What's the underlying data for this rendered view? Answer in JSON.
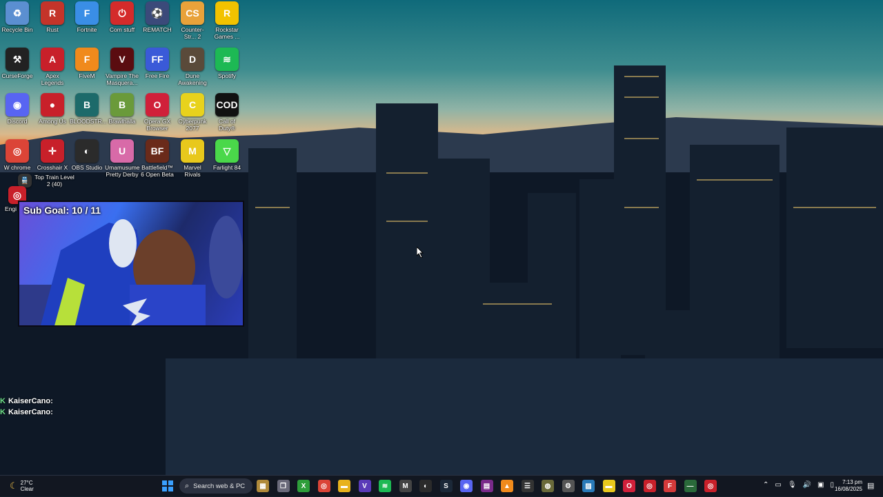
{
  "desktop": {
    "icons": [
      {
        "label": "Recycle Bin",
        "icon": "recycle-bin-icon",
        "color": "#5b8fd1",
        "glyph": "♻"
      },
      {
        "label": "Rust",
        "icon": "rust-icon",
        "color": "#c4342a",
        "glyph": "R"
      },
      {
        "label": "Fortnite",
        "icon": "fortnite-icon",
        "color": "#3a8ee6",
        "glyph": "F"
      },
      {
        "label": "Com stuff",
        "icon": "power-icon",
        "color": "#d42b2b",
        "glyph": "⏻"
      },
      {
        "label": "REMATCH",
        "icon": "rematch-icon",
        "color": "#3b4a7a",
        "glyph": "⚽"
      },
      {
        "label": "Counter-Str... 2",
        "icon": "counter-strike-icon",
        "color": "#e8a23a",
        "glyph": "CS"
      },
      {
        "label": "Rockstar Games ...",
        "icon": "rockstar-icon",
        "color": "#f2c200",
        "glyph": "R"
      },
      {
        "label": "CurseForge",
        "icon": "curseforge-icon",
        "color": "#222222",
        "glyph": "⚒"
      },
      {
        "label": "Apex Legends",
        "icon": "apex-icon",
        "color": "#c8202a",
        "glyph": "A"
      },
      {
        "label": "FiveM",
        "icon": "fivem-icon",
        "color": "#f08a1c",
        "glyph": "F"
      },
      {
        "label": "Vampire The Masquera...",
        "icon": "vampire-icon",
        "color": "#5a0c10",
        "glyph": "V"
      },
      {
        "label": "Free Fire",
        "icon": "free-fire-icon",
        "color": "#3a5ad8",
        "glyph": "FF"
      },
      {
        "label": "Dune Awakening",
        "icon": "dune-icon",
        "color": "#5a4a3a",
        "glyph": "D"
      },
      {
        "label": "Spotify",
        "icon": "spotify-icon",
        "color": "#1db954",
        "glyph": "≋"
      },
      {
        "label": "Discord",
        "icon": "discord-icon",
        "color": "#5865f2",
        "glyph": "◉"
      },
      {
        "label": "Among Us",
        "icon": "among-us-icon",
        "color": "#c8202a",
        "glyph": "●"
      },
      {
        "label": "BLOODSTR...",
        "icon": "bloodstrike-icon",
        "color": "#1d6a6a",
        "glyph": "B"
      },
      {
        "label": "Brawlhalla",
        "icon": "brawlhalla-icon",
        "color": "#6a9a3a",
        "glyph": "B"
      },
      {
        "label": "Opera GX Browser",
        "icon": "opera-gx-icon",
        "color": "#d0203a",
        "glyph": "O"
      },
      {
        "label": "Cyberpunk 2077",
        "icon": "cyberpunk-icon",
        "color": "#e8d21c",
        "glyph": "C"
      },
      {
        "label": "Call of Duty®",
        "icon": "call-of-duty-icon",
        "color": "#111111",
        "glyph": "COD"
      },
      {
        "label": "W chrome",
        "icon": "chrome-icon",
        "color": "#db4437",
        "glyph": "◎"
      },
      {
        "label": "Crosshair X",
        "icon": "crosshair-icon",
        "color": "#c8202a",
        "glyph": "✛"
      },
      {
        "label": "OBS Studio",
        "icon": "obs-icon",
        "color": "#2b2b2b",
        "glyph": "◐"
      },
      {
        "label": "Umamusume Pretty Derby",
        "icon": "umamusume-icon",
        "color": "#d86aa8",
        "glyph": "U"
      },
      {
        "label": "Battlefield™ 6 Open Beta",
        "icon": "battlefield-icon",
        "color": "#6a2a1a",
        "glyph": "BF"
      },
      {
        "label": "Marvel Rivals",
        "icon": "marvel-rivals-icon",
        "color": "#e8c81c",
        "glyph": "M"
      },
      {
        "label": "Farlight 84",
        "icon": "farlight-icon",
        "color": "#4ad84a",
        "glyph": "▽"
      },
      {
        "label": "Top Train Level 2 (40)",
        "icon": "train-icon",
        "color": "#333333",
        "glyph": "🚆"
      },
      {
        "label": "Engi Play",
        "icon": "engine-icon",
        "color": "#c8202a",
        "glyph": "◎"
      }
    ]
  },
  "webcam": {
    "sub_goal_label": "Sub Goal:",
    "sub_goal_value": "10 / 11"
  },
  "chat": {
    "messages": [
      {
        "badge": "K",
        "user": "KaiserCano:"
      },
      {
        "badge": "K",
        "user": "KaiserCano:"
      }
    ]
  },
  "taskbar": {
    "weather_temp": "27°C",
    "weather_desc": "Clear",
    "search_placeholder": "Search web & PC",
    "time": "7:13 pm",
    "date": "16/08/2025",
    "apps": [
      {
        "icon": "widgets-icon",
        "color": "#b08a3a",
        "glyph": "▦"
      },
      {
        "icon": "task-view-icon",
        "color": "#6a6a7a",
        "glyph": "❐"
      },
      {
        "icon": "xbox-icon",
        "color": "#2e9e3a",
        "glyph": "X"
      },
      {
        "icon": "chrome-icon",
        "color": "#db4437",
        "glyph": "◎"
      },
      {
        "icon": "file-explorer-icon",
        "color": "#e8b21c",
        "glyph": "▬"
      },
      {
        "icon": "visual-studio-icon",
        "color": "#5a3ab8",
        "glyph": "V"
      },
      {
        "icon": "spotify-icon",
        "color": "#1db954",
        "glyph": "≋"
      },
      {
        "icon": "msi-icon",
        "color": "#444444",
        "glyph": "M"
      },
      {
        "icon": "obs-icon",
        "color": "#2b2b2b",
        "glyph": "◐"
      },
      {
        "icon": "steam-icon",
        "color": "#1b2838",
        "glyph": "S"
      },
      {
        "icon": "discord-icon",
        "color": "#5865f2",
        "glyph": "◉"
      },
      {
        "icon": "app-icon",
        "color": "#7a2a8a",
        "glyph": "▤"
      },
      {
        "icon": "vlc-icon",
        "color": "#f08a1c",
        "glyph": "▲"
      },
      {
        "icon": "app-icon",
        "color": "#333333",
        "glyph": "☰"
      },
      {
        "icon": "app-icon",
        "color": "#6a6a3a",
        "glyph": "◍"
      },
      {
        "icon": "app-icon",
        "color": "#555555",
        "glyph": "⚙"
      },
      {
        "icon": "photos-icon",
        "color": "#2a7ab8",
        "glyph": "▨"
      },
      {
        "icon": "notes-icon",
        "color": "#e8c81c",
        "glyph": "▬"
      },
      {
        "icon": "opera-gx-icon",
        "color": "#d0203a",
        "glyph": "O"
      },
      {
        "icon": "app-icon",
        "color": "#c8202a",
        "glyph": "◎"
      },
      {
        "icon": "app-icon",
        "color": "#d43a3a",
        "glyph": "F"
      },
      {
        "icon": "app-icon",
        "color": "#2a6a3a",
        "glyph": "—"
      },
      {
        "icon": "app-icon",
        "color": "#c8202a",
        "glyph": "◎"
      }
    ]
  }
}
